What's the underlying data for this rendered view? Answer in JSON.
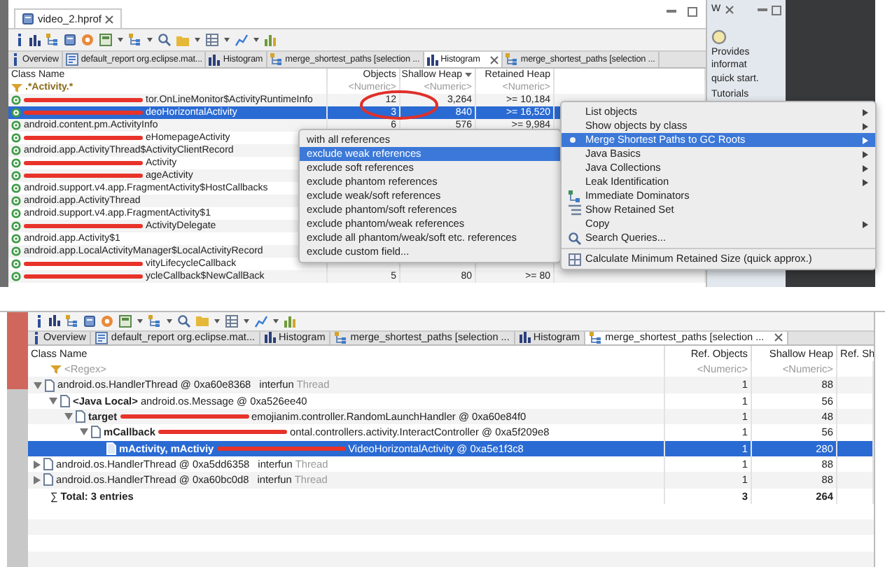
{
  "top_view": {
    "editor_tab": "video_2.hprof",
    "tabs": [
      {
        "label": "Overview",
        "kind": "info",
        "selected": false
      },
      {
        "label": "default_report org.eclipse.mat...",
        "kind": "report",
        "selected": false
      },
      {
        "label": "Histogram",
        "kind": "histogram",
        "selected": false
      },
      {
        "label": "merge_shortest_paths [selection ...",
        "kind": "paths",
        "selected": false
      },
      {
        "label": "Histogram",
        "kind": "histogram",
        "selected": true
      },
      {
        "label": "merge_shortest_paths [selection ...",
        "kind": "paths",
        "selected": false
      }
    ],
    "table": {
      "columns": [
        {
          "label": "Class Name",
          "sorted": false
        },
        {
          "label": "Objects",
          "sorted": false
        },
        {
          "label": "Shallow Heap",
          "sorted": true
        },
        {
          "label": "Retained Heap",
          "sorted": false
        }
      ],
      "rows": [
        {
          "kind": "filter",
          "text": ".*Activity.*",
          "selected": false,
          "cells": [
            "<Numeric>",
            "<Numeric>",
            "<Numeric>"
          ]
        },
        {
          "kind": "class",
          "text": "tor.OnLineMonitor$ActivityRuntimeInfo",
          "redacted": true,
          "selected": false,
          "cells": [
            "12",
            "3,264",
            ">= 10,184"
          ]
        },
        {
          "kind": "class",
          "text": "deoHorizontalActivity",
          "redacted": true,
          "selected": true,
          "cells": [
            "3",
            "840",
            ">= 16,520"
          ]
        },
        {
          "kind": "class",
          "text": "android.content.pm.ActivityInfo",
          "redacted": false,
          "selected": false,
          "cells": [
            "6",
            "576",
            ">= 9,984"
          ]
        },
        {
          "kind": "class",
          "text": "eHomepageActivity",
          "redacted": true,
          "selected": false
        },
        {
          "kind": "class",
          "text": "android.app.ActivityThread$ActivityClientRecord",
          "redacted": false,
          "selected": false
        },
        {
          "kind": "class",
          "text": "Activity",
          "redacted": true,
          "selected": false
        },
        {
          "kind": "class",
          "text": "ageActivity",
          "redacted": true,
          "selected": false
        },
        {
          "kind": "class",
          "text": "android.support.v4.app.FragmentActivity$HostCallbacks",
          "redacted": false,
          "selected": false
        },
        {
          "kind": "class",
          "text": "android.app.ActivityThread",
          "redacted": false,
          "selected": false
        },
        {
          "kind": "class",
          "text": "android.support.v4.app.FragmentActivity$1",
          "redacted": false,
          "selected": false
        },
        {
          "kind": "class",
          "text": "ActivityDelegate",
          "redacted": true,
          "selected": false
        },
        {
          "kind": "class",
          "text": "android.app.Activity$1",
          "redacted": false,
          "selected": false
        },
        {
          "kind": "class",
          "text": "android.app.LocalActivityManager$LocalActivityRecord",
          "redacted": false,
          "selected": false
        },
        {
          "kind": "class",
          "text": "vityLifecycleCallback",
          "redacted": true,
          "selected": false
        },
        {
          "kind": "class",
          "text": "ycleCallback$NewCallBack",
          "redacted": true,
          "selected": false,
          "cells": [
            "5",
            "80",
            ">= 80"
          ]
        }
      ]
    },
    "submenu": {
      "items": [
        {
          "label": "with all references",
          "selected": false
        },
        {
          "label": "exclude weak references",
          "selected": true
        },
        {
          "label": "exclude soft references",
          "selected": false
        },
        {
          "label": "exclude phantom references",
          "selected": false
        },
        {
          "label": "exclude weak/soft references",
          "selected": false
        },
        {
          "label": "exclude phantom/soft references",
          "selected": false
        },
        {
          "label": "exclude phantom/weak references",
          "selected": false
        },
        {
          "label": "exclude all phantom/weak/soft etc. references",
          "selected": false
        },
        {
          "label": "exclude custom field...",
          "selected": false
        }
      ]
    },
    "context_menu": {
      "items": [
        {
          "label": "List objects",
          "kind": "plain",
          "submenu": true,
          "selected": false
        },
        {
          "label": "Show objects by class",
          "kind": "plain",
          "submenu": true,
          "selected": false
        },
        {
          "label": "Merge Shortest Paths to GC Roots",
          "kind": "merge",
          "submenu": true,
          "selected": true
        },
        {
          "label": "Java Basics",
          "kind": "plain",
          "submenu": true,
          "selected": false
        },
        {
          "label": "Java Collections",
          "kind": "plain",
          "submenu": true,
          "selected": false
        },
        {
          "label": "Leak Identification",
          "kind": "plain",
          "submenu": true,
          "selected": false
        },
        {
          "label": "Immediate Dominators",
          "kind": "dominator",
          "submenu": false,
          "selected": false
        },
        {
          "label": "Show Retained Set",
          "kind": "retained",
          "submenu": false,
          "selected": false
        },
        {
          "label": "Copy",
          "kind": "plain",
          "submenu": true,
          "selected": false
        },
        {
          "label": "Search Queries...",
          "kind": "search",
          "submenu": false,
          "selected": false
        },
        {
          "label": "Calculate Minimum Retained Size (quick approx.)",
          "kind": "calc",
          "submenu": false,
          "selected": false,
          "divider_before": true
        }
      ]
    },
    "side_view": {
      "title": "W",
      "lines": [
        "Provides informat",
        "quick start.",
        "Tutorials"
      ]
    }
  },
  "bottom_view": {
    "tabs": [
      {
        "label": "Overview",
        "kind": "info",
        "selected": false
      },
      {
        "label": "default_report org.eclipse.mat...",
        "kind": "report",
        "selected": false
      },
      {
        "label": "Histogram",
        "kind": "histogram",
        "selected": false
      },
      {
        "label": "merge_shortest_paths [selection ...",
        "kind": "paths",
        "selected": false
      },
      {
        "label": "Histogram",
        "kind": "histogram",
        "selected": false
      },
      {
        "label": "merge_shortest_paths [selection ...",
        "kind": "paths",
        "selected": true
      }
    ],
    "table": {
      "columns": [
        "Class Name",
        "Ref. Objects",
        "Shallow Heap",
        "Ref. Sh"
      ],
      "filter_row": {
        "text": "<Regex>",
        "cells": [
          "<Numeric>",
          "<Numeric>"
        ]
      },
      "tree": [
        {
          "text": "android.os.HandlerThread @ 0xa60e8368",
          "owner": "interfun",
          "note": "Thread",
          "redacted": false,
          "cells": [
            "1",
            "88"
          ],
          "expanded": true,
          "selected": false,
          "children": [
            {
              "field": "<Java Local>",
              "text": "android.os.Message @ 0xa526ee40",
              "redacted": false,
              "cells": [
                "1",
                "56"
              ],
              "expanded": true,
              "selected": false,
              "children": [
                {
                  "field": "target",
                  "text": "emojianim.controller.RandomLaunchHandler @ 0xa60e84f0",
                  "redacted": true,
                  "cells": [
                    "1",
                    "48"
                  ],
                  "expanded": true,
                  "selected": false,
                  "children": [
                    {
                      "field": "mCallback",
                      "text": "ontal.controllers.activity.InteractController @ 0xa5f209e8",
                      "redacted": true,
                      "cells": [
                        "1",
                        "56"
                      ],
                      "expanded": true,
                      "selected": false,
                      "children": [
                        {
                          "field": "mActivity, mActiviy",
                          "text": "VideoHorizontalActivity @ 0xa5e1f3c8",
                          "redacted": true,
                          "cells": [
                            "1",
                            "280"
                          ],
                          "selected": true
                        }
                      ]
                    }
                  ]
                }
              ]
            }
          ]
        },
        {
          "text": "android.os.HandlerThread @ 0xa5dd6358",
          "owner": "interfun",
          "note": "Thread",
          "redacted": false,
          "cells": [
            "1",
            "88"
          ],
          "expanded": false,
          "selected": false
        },
        {
          "text": "android.os.HandlerThread @ 0xa60bc0d8",
          "owner": "interfun",
          "note": "Thread",
          "redacted": false,
          "cells": [
            "1",
            "88"
          ],
          "expanded": false,
          "selected": false
        }
      ],
      "total": {
        "symbol": "∑",
        "text": "Total: 3 entries",
        "cells": [
          "3",
          "264"
        ]
      }
    }
  }
}
